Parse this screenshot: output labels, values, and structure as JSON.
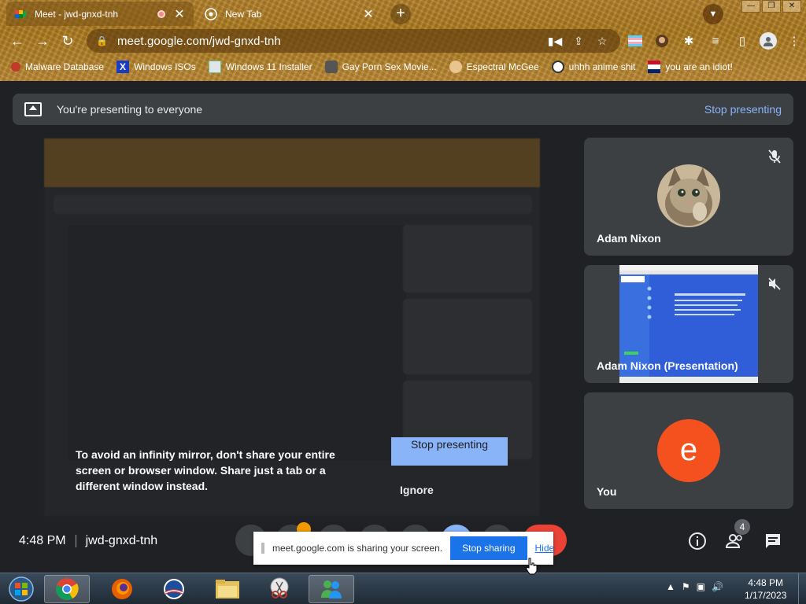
{
  "browser": {
    "tabs": [
      {
        "title": "Meet - jwd-gnxd-tnh",
        "close": "✕"
      },
      {
        "title": "New Tab",
        "close": "✕"
      }
    ],
    "new_tab": "+",
    "window_buttons": [
      "—",
      "❐",
      "✕"
    ],
    "url": "meet.google.com/jwd-gnxd-tnh",
    "bookmarks": [
      "Malware Database",
      "Windows ISOs",
      "Windows 11 Installer",
      "Gay Porn Sex Movie...",
      "Espectral McGee",
      "uhhh anime shit",
      "you are an idiot!"
    ]
  },
  "meet": {
    "banner_text": "You're presenting to everyone",
    "banner_stop": "Stop presenting",
    "participants": [
      {
        "name": "Adam Nixon"
      },
      {
        "name": "Adam Nixon (Presentation)"
      },
      {
        "name": "You",
        "initial": "e"
      }
    ],
    "warning": "To avoid an infinity mirror, don't share your entire screen or browser window. Share just a tab or a different window instead.",
    "stop_presenting_button": "Stop presenting",
    "ignore_button": "Ignore",
    "time": "4:48 PM",
    "meeting_code": "jwd-gnxd-tnh",
    "people_count": "4"
  },
  "share_bar": {
    "message": "meet.google.com is sharing your screen.",
    "stop_label": "Stop sharing",
    "hide_label": "Hide"
  },
  "taskbar": {
    "time": "4:48 PM",
    "date": "1/17/2023"
  },
  "colors": {
    "meet_bg": "#202124",
    "tile_bg": "#3c4043",
    "accent_blue": "#8ab4f8",
    "end_call_red": "#ea4335",
    "avatar_orange": "#f4511e"
  }
}
